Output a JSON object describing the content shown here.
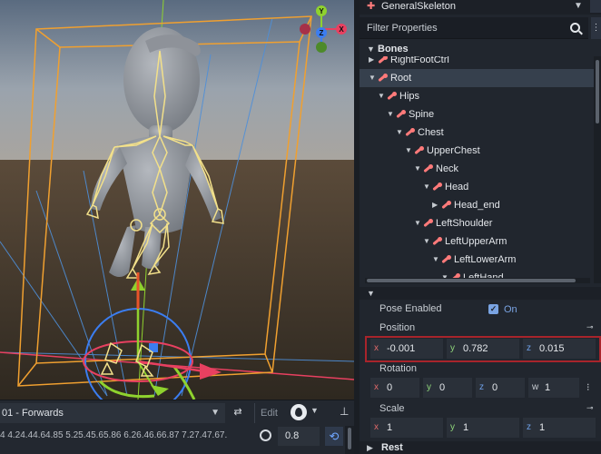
{
  "viewport": {
    "gizmo_axes": [
      "Y",
      "X",
      "Z"
    ],
    "colors": {
      "x_axis": "#e84060",
      "y_axis": "#8fd22e",
      "z_axis": "#3b7df0",
      "bounds": "#f0a030",
      "skeleton": "#f2e08a",
      "mesh": "#8f939a"
    }
  },
  "animation": {
    "selected": "01 - Forwards",
    "edit_label": "Edit",
    "ruler": "4  4.24.44.64.85  5.25.45.65.86  6.26.46.66.87  7.27.47.67.",
    "step": "0.8",
    "icons": {
      "loop": "loop-icon",
      "blend": "onion-icon",
      "pin": "pin-icon",
      "timer": "timer-icon",
      "snap": "snap-icon"
    }
  },
  "inspector": {
    "title": "GeneralSkeleton",
    "filter_placeholder": "Filter Properties",
    "bones_label": "Bones",
    "bones": [
      {
        "name": "RightFootCtrl",
        "depth": 1,
        "expanded": false,
        "selected": false
      },
      {
        "name": "Root",
        "depth": 1,
        "expanded": true,
        "selected": true
      },
      {
        "name": "Hips",
        "depth": 2,
        "expanded": true,
        "selected": false
      },
      {
        "name": "Spine",
        "depth": 3,
        "expanded": true,
        "selected": false
      },
      {
        "name": "Chest",
        "depth": 4,
        "expanded": true,
        "selected": false
      },
      {
        "name": "UpperChest",
        "depth": 5,
        "expanded": true,
        "selected": false
      },
      {
        "name": "Neck",
        "depth": 6,
        "expanded": true,
        "selected": false
      },
      {
        "name": "Head",
        "depth": 7,
        "expanded": true,
        "selected": false
      },
      {
        "name": "Head_end",
        "depth": 8,
        "expanded": false,
        "selected": false
      },
      {
        "name": "LeftShoulder",
        "depth": 6,
        "expanded": true,
        "selected": false
      },
      {
        "name": "LeftUpperArm",
        "depth": 7,
        "expanded": true,
        "selected": false
      },
      {
        "name": "LeftLowerArm",
        "depth": 8,
        "expanded": true,
        "selected": false
      },
      {
        "name": "LeftHand",
        "depth": 9,
        "expanded": true,
        "selected": false
      }
    ],
    "pose_enabled_label": "Pose Enabled",
    "pose_enabled_value": "On",
    "position_label": "Position",
    "position": {
      "x": "-0.001",
      "y": "0.782",
      "z": "0.015"
    },
    "rotation_label": "Rotation",
    "rotation": {
      "x": "0",
      "y": "0",
      "z": "0",
      "w": "1"
    },
    "scale_label": "Scale",
    "scale": {
      "x": "1",
      "y": "1",
      "z": "1"
    },
    "rest_label": "Rest"
  }
}
